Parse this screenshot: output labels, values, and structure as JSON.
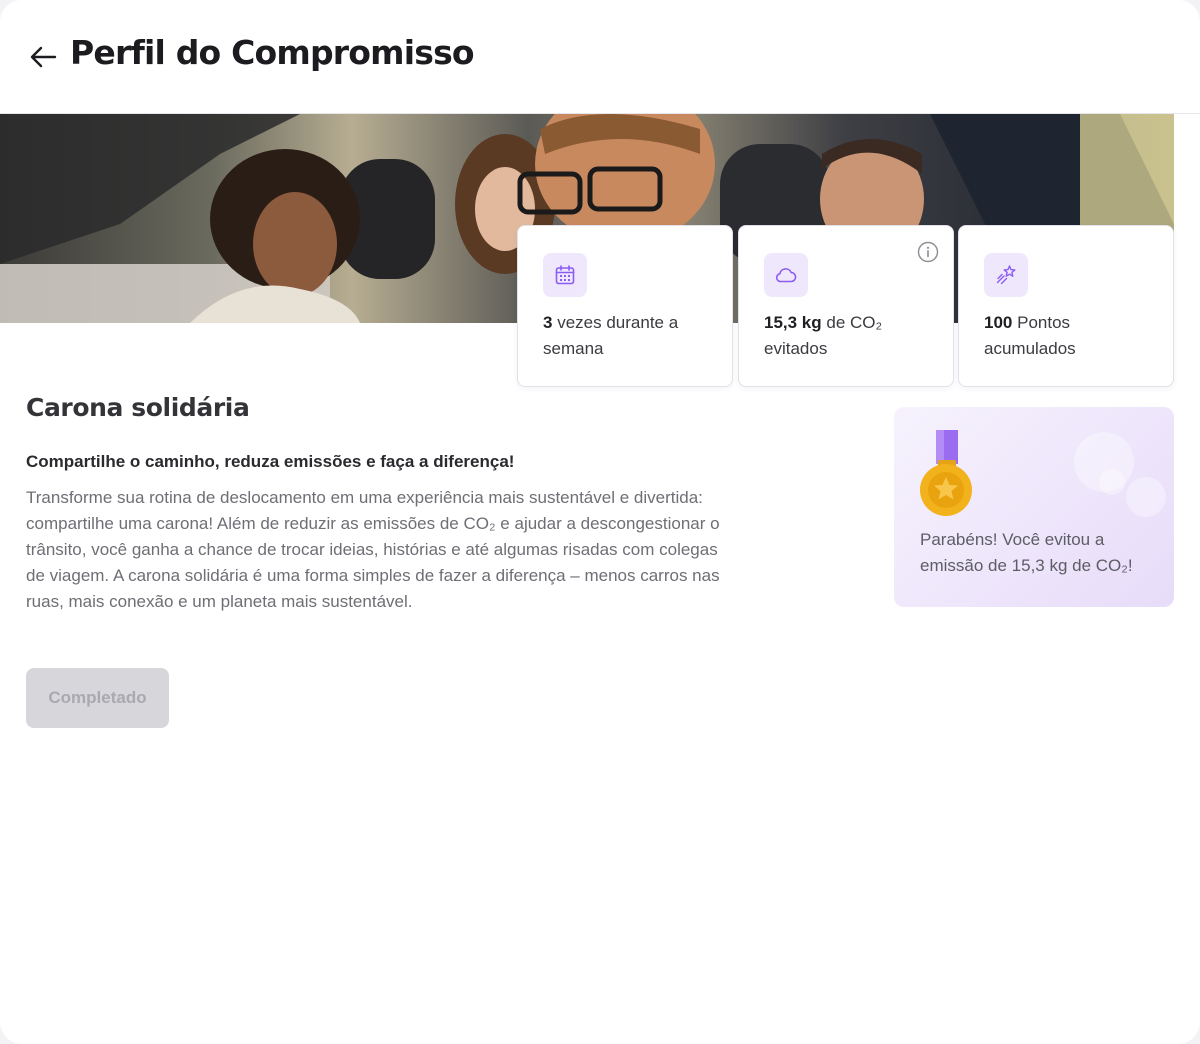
{
  "header": {
    "title": "Perfil do Compromisso",
    "back_icon": "arrow-left-icon"
  },
  "stats": [
    {
      "icon": "calendar-icon",
      "value": "3",
      "text": "vezes durante a semana"
    },
    {
      "icon": "cloud-icon",
      "value": "15,3 kg",
      "text": "de CO₂ evitados",
      "info_icon": "info-icon"
    },
    {
      "icon": "sparkle-star-icon",
      "value": "100",
      "text": "Pontos acumulados"
    }
  ],
  "content": {
    "title": "Carona solidária",
    "subtitle": "Compartilhe o caminho, reduza emissões e faça a diferença!",
    "description": "Transforme sua rotina de deslocamento em uma experiência mais sustentável e divertida: compartilhe uma carona! Além de reduzir as emissões de CO₂ e ajudar a descongestionar o trânsito, você ganha a chance de trocar ideias, histórias e até algumas risadas com colegas de viagem. A carona solidária é uma forma simples de fazer a diferença – menos carros nas ruas, mais conexão e um planeta mais sustentável.",
    "button_label": "Completado"
  },
  "achievement": {
    "icon": "medal-icon",
    "message": "Parabéns! Você evitou a emissão de 15,3 kg de CO₂!"
  },
  "colors": {
    "accent": "#8b5cf6",
    "icon_bg": "#efe8fd",
    "medal_gold": "#f2b21b",
    "ribbon": "#9b6bf0",
    "disabled_button": "#d6d6db"
  }
}
